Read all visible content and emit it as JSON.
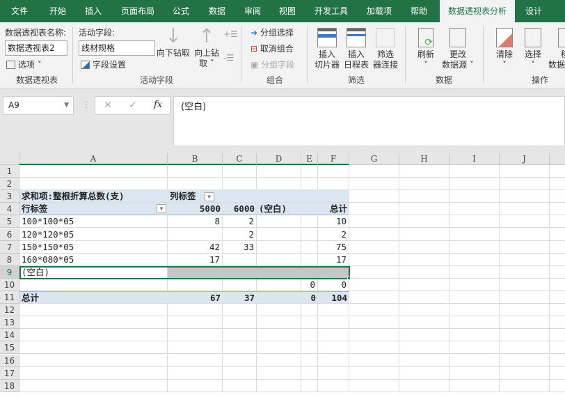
{
  "tabs": [
    "文件",
    "开始",
    "插入",
    "页面布局",
    "公式",
    "数据",
    "审阅",
    "视图",
    "开发工具",
    "加载项",
    "帮助",
    "数据透视表分析",
    "设计"
  ],
  "ribbon": {
    "pivot_name_label": "数据透视表名称:",
    "pivot_name_value": "数据透视表2",
    "options": "选项",
    "group_pivot": "数据透视表",
    "active_field_label": "活动字段:",
    "active_field_value": "线材规格",
    "field_settings": "字段设置",
    "drill_down": "向下钻取",
    "drill_up_1": "向上钻",
    "drill_up_2": "取",
    "group_active": "活动字段",
    "group_selection": "分组选择",
    "ungroup": "取消组合",
    "group_field": "分组字段",
    "group_group": "组合",
    "slicer_1": "插入",
    "slicer_2": "切片器",
    "timeline_1": "插入",
    "timeline_2": "日程表",
    "filter_conn_1": "筛选",
    "filter_conn_2": "器连接",
    "group_filter": "筛选",
    "refresh": "刷新",
    "change_src_1": "更改",
    "change_src_2": "数据源",
    "group_data": "数据",
    "clear": "清除",
    "select": "选择",
    "move_1": "移",
    "move_2": "数据",
    "group_actions": "操作"
  },
  "formula_bar": {
    "name_box": "A9",
    "formula": "(空白)"
  },
  "columns": [
    "A",
    "B",
    "C",
    "D",
    "E",
    "F",
    "G",
    "H",
    "I",
    "J"
  ],
  "rows": [
    "1",
    "2",
    "3",
    "4",
    "5",
    "6",
    "7",
    "8",
    "9",
    "10",
    "11",
    "12",
    "13",
    "14",
    "15",
    "16",
    "17",
    "18"
  ],
  "cells": {
    "r3": {
      "A": "求和项:整根折算总数(支)",
      "B": "列标签"
    },
    "r4": {
      "A": "行标签",
      "B": "5000",
      "C": "6000",
      "D": "(空白)",
      "F": "总计"
    },
    "r5": {
      "A": "100*100*05",
      "B": "8",
      "C": "2",
      "F": "10"
    },
    "r6": {
      "A": "120*120*05",
      "C": "2",
      "F": "2"
    },
    "r7": {
      "A": "150*150*05",
      "B": "42",
      "C": "33",
      "F": "75"
    },
    "r8": {
      "A": "160*080*05",
      "B": "17",
      "F": "17"
    },
    "r9": {
      "A": "(空白)"
    },
    "r10": {
      "E": "0",
      "F": "0"
    },
    "r11": {
      "A": "总计",
      "B": "67",
      "C": "37",
      "E": "0",
      "F": "104"
    }
  },
  "colors": {
    "accent": "#217346",
    "pivot_header": "#dce6f1",
    "selection_fill": "#c6c6c6"
  }
}
